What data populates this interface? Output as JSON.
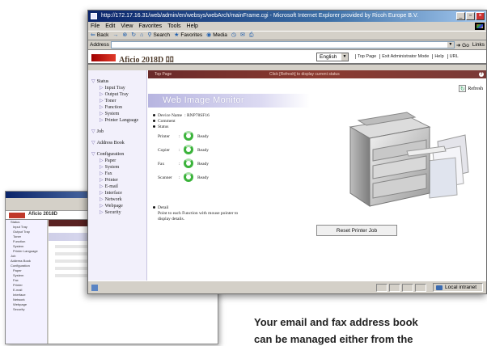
{
  "window": {
    "title": "http://172.17.16.31/web/admin/en/websys/webArch/mainFrame.cgi - Microsoft Internet Explorer provided by Ricoh Europe B.V.",
    "controls": [
      "_",
      "▫",
      "×"
    ]
  },
  "menu": [
    "File",
    "Edit",
    "View",
    "Favorites",
    "Tools",
    "Help"
  ],
  "toolbar": {
    "back": "Back",
    "search": "Search",
    "favorites": "Favorites",
    "media": "Media"
  },
  "address": {
    "label": "Address",
    "go": "Go",
    "links": "Links"
  },
  "banner": {
    "product": "Aficio 2018D",
    "product_suffix": "ﾛﾛ",
    "language": "English",
    "links": [
      "Top Page",
      "Exit Administrator Mode",
      "Help",
      "URL"
    ]
  },
  "strip": {
    "top_page": "Top Page",
    "hint": "Click [Refresh] to display current status",
    "help_glyph": "?"
  },
  "sidebar": [
    {
      "label": "Status",
      "level": "cat"
    },
    {
      "label": "Input Tray",
      "level": "sub"
    },
    {
      "label": "Output Tray",
      "level": "sub"
    },
    {
      "label": "Toner",
      "level": "sub"
    },
    {
      "label": "Function",
      "level": "sub"
    },
    {
      "label": "System",
      "level": "sub"
    },
    {
      "label": "Printer Language",
      "level": "sub"
    },
    {
      "label": "Job",
      "level": "cat"
    },
    {
      "label": "Address Book",
      "level": "cat"
    },
    {
      "label": "Configuration",
      "level": "cat"
    },
    {
      "label": "Paper",
      "level": "sub"
    },
    {
      "label": "System",
      "level": "sub"
    },
    {
      "label": "Fax",
      "level": "sub"
    },
    {
      "label": "Printer",
      "level": "sub"
    },
    {
      "label": "E-mail",
      "level": "sub"
    },
    {
      "label": "Interface",
      "level": "sub"
    },
    {
      "label": "Network",
      "level": "sub"
    },
    {
      "label": "Webpage",
      "level": "sub"
    },
    {
      "label": "Security",
      "level": "sub"
    }
  ],
  "main": {
    "refresh": "Refresh",
    "heading": "Web Image Monitor",
    "device_name_label": "Device Name",
    "device_name_value": ": RNP78SF16",
    "comment_label": "Comment",
    "status_label": "Status",
    "statuses": [
      {
        "name": "Printer",
        "value": "Ready"
      },
      {
        "name": "Copier",
        "value": "Ready"
      },
      {
        "name": "Fax",
        "value": "Ready"
      },
      {
        "name": "Scanner",
        "value": "Ready"
      }
    ],
    "detail_label": "Detail",
    "detail_text_1": "Point to each Function with mouse pointer to",
    "detail_text_2": "display details.",
    "reset_button": "Reset Printer Job"
  },
  "statusbar": {
    "zone": "Local intranet"
  },
  "inset": {
    "product": "Aficio 2018D",
    "reset_button": "Reset Printer Job"
  },
  "caption": {
    "line1": "Your email and fax address book",
    "line2": "can be managed either from the"
  },
  "colors": {
    "accent_red": "#c0392b",
    "strip_maroon": "#6a2a2a",
    "ready_green": "#3bb33b",
    "sidebar_bg": "#f2f0fb"
  }
}
